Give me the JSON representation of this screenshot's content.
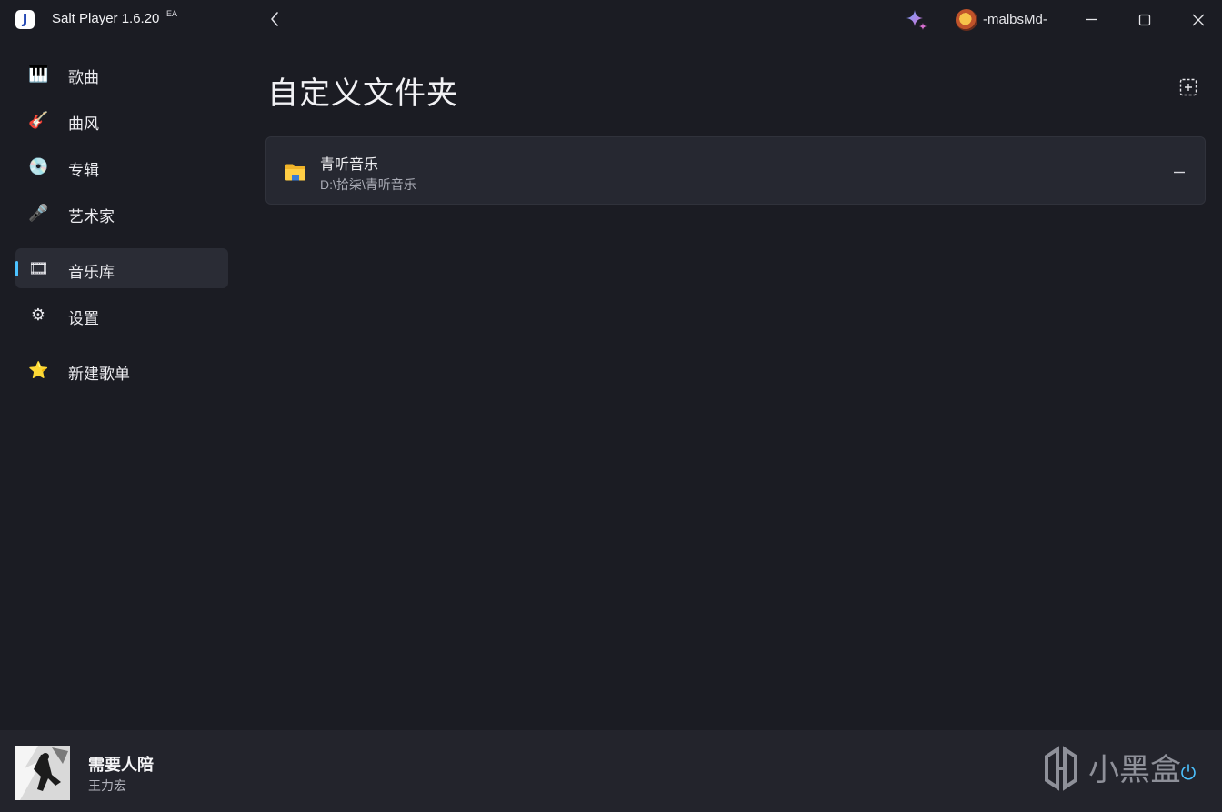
{
  "titlebar": {
    "app_name": "Salt Player 1.6.20",
    "badge": "EA",
    "logo_letter": "J",
    "username": "-malbsMd-"
  },
  "sidebar": {
    "items": [
      {
        "label": "歌曲",
        "icon": "piano-keys-icon",
        "emoji": "🎹"
      },
      {
        "label": "曲风",
        "icon": "guitar-icon",
        "emoji": "🎸"
      },
      {
        "label": "专辑",
        "icon": "vinyl-record-icon",
        "emoji": "💿"
      },
      {
        "label": "艺术家",
        "icon": "microphone-icon",
        "emoji": "🎤"
      },
      {
        "label": "音乐库",
        "icon": "film-strip-icon",
        "emoji": "🎞",
        "active": true
      },
      {
        "label": "设置",
        "icon": "gear-icon",
        "emoji": "⚙"
      },
      {
        "label": "新建歌单",
        "icon": "star-icon",
        "emoji": "⭐"
      }
    ]
  },
  "main": {
    "title": "自定义文件夹",
    "folders": [
      {
        "name": "青听音乐",
        "path": "D:\\拾柒\\青听音乐"
      }
    ]
  },
  "player": {
    "song_title": "需要人陪",
    "artist": "王力宏"
  },
  "watermark": {
    "text": "小黑盒"
  },
  "colors": {
    "background": "#1b1c23",
    "card": "#262831",
    "active_indicator": "#4cc2ff",
    "player_bar": "#23242c"
  }
}
